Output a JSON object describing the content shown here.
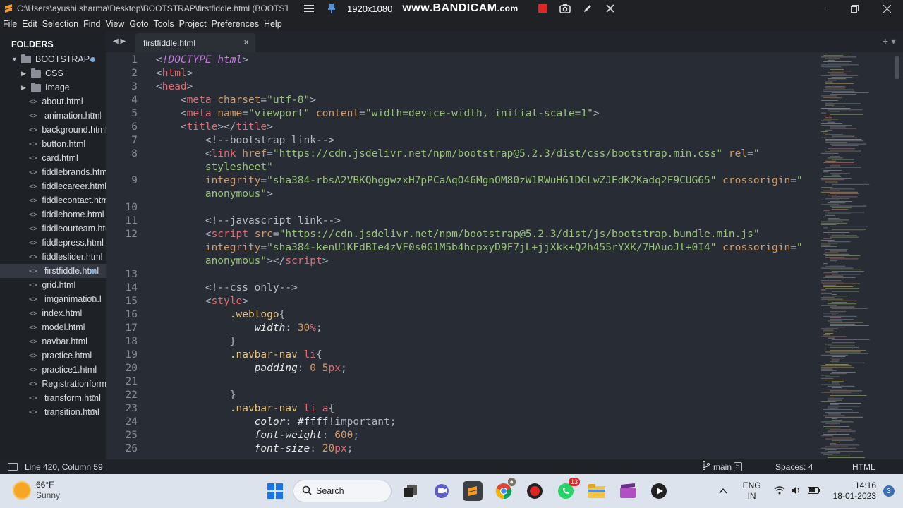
{
  "titlebar": {
    "title": "C:\\Users\\ayushi sharma\\Desktop\\BOOTSTRAP\\firstfiddle.html (BOOTSTRAP) - Sublime Text (UNREGISTERED)",
    "resolution": "1920x1080",
    "brand_main": "www.BANDICAM",
    "brand_suffix": ".com"
  },
  "menu": [
    "File",
    "Edit",
    "Selection",
    "Find",
    "View",
    "Goto",
    "Tools",
    "Project",
    "Preferences",
    "Help"
  ],
  "sidebar": {
    "header": "FOLDERS",
    "root": "BOOTSTRAP",
    "folders": [
      "CSS",
      "Image"
    ],
    "files": [
      {
        "name": "about.html",
        "mark": ""
      },
      {
        "name": "animation.html",
        "mark": "ring"
      },
      {
        "name": "background.html",
        "mark": ""
      },
      {
        "name": "button.html",
        "mark": ""
      },
      {
        "name": "card.html",
        "mark": ""
      },
      {
        "name": "fiddlebrands.html",
        "mark": ""
      },
      {
        "name": "fiddlecareer.html",
        "mark": ""
      },
      {
        "name": "fiddlecontact.html",
        "mark": ""
      },
      {
        "name": "fiddlehome.html",
        "mark": ""
      },
      {
        "name": "fiddleourteam.html",
        "mark": ""
      },
      {
        "name": "fiddlepress.html",
        "mark": ""
      },
      {
        "name": "fiddleslider.html",
        "mark": ""
      },
      {
        "name": "firstfiddle.html",
        "mark": "filled",
        "active": true
      },
      {
        "name": "grid.html",
        "mark": ""
      },
      {
        "name": "imganimation.html",
        "mark": "ring"
      },
      {
        "name": "index.html",
        "mark": ""
      },
      {
        "name": "model.html",
        "mark": ""
      },
      {
        "name": "navbar.html",
        "mark": ""
      },
      {
        "name": "practice.html",
        "mark": ""
      },
      {
        "name": "practice1.html",
        "mark": ""
      },
      {
        "name": "Registrationform.html",
        "mark": ""
      },
      {
        "name": "transform.html",
        "mark": "ring"
      },
      {
        "name": "transition.html",
        "mark": "ring"
      }
    ]
  },
  "tab": {
    "label": "firstfiddle.html",
    "close": "×"
  },
  "editor": {
    "lines": [
      {
        "n": "1",
        "tokens": [
          [
            "c-punc",
            "<"
          ],
          [
            "c-kw",
            "!DOCTYPE"
          ],
          [
            "c-txt",
            " "
          ],
          [
            "c-kw",
            "html"
          ],
          [
            "c-punc",
            ">"
          ]
        ]
      },
      {
        "n": "2",
        "tokens": [
          [
            "c-punc",
            "<"
          ],
          [
            "c-tag",
            "html"
          ],
          [
            "c-punc",
            ">"
          ]
        ]
      },
      {
        "n": "3",
        "tokens": [
          [
            "c-punc",
            "<"
          ],
          [
            "c-tag",
            "head"
          ],
          [
            "c-punc",
            ">"
          ]
        ]
      },
      {
        "n": "4",
        "tokens": [
          [
            "c-txt",
            "    "
          ],
          [
            "c-punc",
            "<"
          ],
          [
            "c-tag",
            "meta"
          ],
          [
            "c-txt",
            " "
          ],
          [
            "c-attr",
            "charset"
          ],
          [
            "c-punc",
            "="
          ],
          [
            "c-str",
            "\"utf-8\""
          ],
          [
            "c-punc",
            ">"
          ]
        ]
      },
      {
        "n": "5",
        "tokens": [
          [
            "c-txt",
            "    "
          ],
          [
            "c-punc",
            "<"
          ],
          [
            "c-tag",
            "meta"
          ],
          [
            "c-txt",
            " "
          ],
          [
            "c-attr",
            "name"
          ],
          [
            "c-punc",
            "="
          ],
          [
            "c-str",
            "\"viewport\""
          ],
          [
            "c-txt",
            " "
          ],
          [
            "c-attr",
            "content"
          ],
          [
            "c-punc",
            "="
          ],
          [
            "c-str",
            "\"width=device-width, initial-scale=1\""
          ],
          [
            "c-punc",
            ">"
          ]
        ]
      },
      {
        "n": "6",
        "tokens": [
          [
            "c-txt",
            "    "
          ],
          [
            "c-punc",
            "<"
          ],
          [
            "c-tag",
            "title"
          ],
          [
            "c-punc",
            "></"
          ],
          [
            "c-tag",
            "title"
          ],
          [
            "c-punc",
            ">"
          ]
        ]
      },
      {
        "n": "7",
        "tokens": [
          [
            "c-txt",
            "        "
          ],
          [
            "c-com",
            "<!--bootstrap link-->"
          ]
        ]
      },
      {
        "n": "8",
        "tokens": [
          [
            "c-txt",
            "        "
          ],
          [
            "c-punc",
            "<"
          ],
          [
            "c-tag",
            "link"
          ],
          [
            "c-txt",
            " "
          ],
          [
            "c-attr",
            "href"
          ],
          [
            "c-punc",
            "="
          ],
          [
            "c-str",
            "\"https://cdn.jsdelivr.net/npm/bootstrap@5.2.3/dist/css/bootstrap.min.css\""
          ],
          [
            "c-txt",
            " "
          ],
          [
            "c-attr",
            "rel"
          ],
          [
            "c-punc",
            "="
          ],
          [
            "c-str",
            "\""
          ]
        ]
      },
      {
        "n": "",
        "tokens": [
          [
            "c-txt",
            "        "
          ],
          [
            "c-str",
            "stylesheet\""
          ]
        ]
      },
      {
        "n": "9",
        "tokens": [
          [
            "c-txt",
            "        "
          ],
          [
            "c-attr",
            "integrity"
          ],
          [
            "c-punc",
            "="
          ],
          [
            "c-str",
            "\"sha384-rbsA2VBKQhggwzxH7pPCaAqO46MgnOM80zW1RWuH61DGLwZJEdK2Kadq2F9CUG65\""
          ],
          [
            "c-txt",
            " "
          ],
          [
            "c-attr",
            "crossorigin"
          ],
          [
            "c-punc",
            "="
          ],
          [
            "c-str",
            "\""
          ]
        ]
      },
      {
        "n": "",
        "tokens": [
          [
            "c-txt",
            "        "
          ],
          [
            "c-str",
            "anonymous\""
          ],
          [
            "c-punc",
            ">"
          ]
        ]
      },
      {
        "n": "10",
        "tokens": []
      },
      {
        "n": "11",
        "tokens": [
          [
            "c-txt",
            "        "
          ],
          [
            "c-com",
            "<!--javascript link-->"
          ]
        ]
      },
      {
        "n": "12",
        "tokens": [
          [
            "c-txt",
            "        "
          ],
          [
            "c-punc",
            "<"
          ],
          [
            "c-tag",
            "script"
          ],
          [
            "c-txt",
            " "
          ],
          [
            "c-attr",
            "src"
          ],
          [
            "c-punc",
            "="
          ],
          [
            "c-str",
            "\"https://cdn.jsdelivr.net/npm/bootstrap@5.2.3/dist/js/bootstrap.bundle.min.js\""
          ]
        ]
      },
      {
        "n": "",
        "tokens": [
          [
            "c-txt",
            "        "
          ],
          [
            "c-attr",
            "integrity"
          ],
          [
            "c-punc",
            "="
          ],
          [
            "c-str",
            "\"sha384-kenU1KFdBIe4zVF0s0G1M5b4hcpxyD9F7jL+jjXkk+Q2h455rYXK/7HAuoJl+0I4\""
          ],
          [
            "c-txt",
            " "
          ],
          [
            "c-attr",
            "crossorigin"
          ],
          [
            "c-punc",
            "="
          ],
          [
            "c-str",
            "\""
          ]
        ]
      },
      {
        "n": "",
        "tokens": [
          [
            "c-txt",
            "        "
          ],
          [
            "c-str",
            "anonymous\""
          ],
          [
            "c-punc",
            "></"
          ],
          [
            "c-tag",
            "script"
          ],
          [
            "c-punc",
            ">"
          ]
        ]
      },
      {
        "n": "13",
        "tokens": []
      },
      {
        "n": "14",
        "tokens": [
          [
            "c-txt",
            "        "
          ],
          [
            "c-com",
            "<!--css only-->"
          ]
        ]
      },
      {
        "n": "15",
        "tokens": [
          [
            "c-txt",
            "        "
          ],
          [
            "c-punc",
            "<"
          ],
          [
            "c-tag",
            "style"
          ],
          [
            "c-punc",
            ">"
          ]
        ]
      },
      {
        "n": "16",
        "tokens": [
          [
            "c-txt",
            "            "
          ],
          [
            "c-sel",
            ".weblogo"
          ],
          [
            "c-punc",
            "{"
          ]
        ]
      },
      {
        "n": "17",
        "tokens": [
          [
            "c-txt",
            "                "
          ],
          [
            "c-prop",
            "width"
          ],
          [
            "c-punc",
            ": "
          ],
          [
            "c-num",
            "30"
          ],
          [
            "c-unit",
            "%"
          ],
          [
            "c-punc",
            ";"
          ]
        ]
      },
      {
        "n": "18",
        "tokens": [
          [
            "c-txt",
            "            "
          ],
          [
            "c-punc",
            "}"
          ]
        ]
      },
      {
        "n": "19",
        "tokens": [
          [
            "c-txt",
            "            "
          ],
          [
            "c-sel",
            ".navbar-nav"
          ],
          [
            "c-txt",
            " "
          ],
          [
            "c-tag",
            "li"
          ],
          [
            "c-punc",
            "{"
          ]
        ]
      },
      {
        "n": "20",
        "tokens": [
          [
            "c-txt",
            "                "
          ],
          [
            "c-prop",
            "padding"
          ],
          [
            "c-punc",
            ": "
          ],
          [
            "c-num",
            "0"
          ],
          [
            "c-txt",
            " "
          ],
          [
            "c-num",
            "5"
          ],
          [
            "c-unit",
            "px"
          ],
          [
            "c-punc",
            ";"
          ]
        ]
      },
      {
        "n": "21",
        "tokens": []
      },
      {
        "n": "22",
        "tokens": [
          [
            "c-txt",
            "            "
          ],
          [
            "c-punc",
            "}"
          ]
        ]
      },
      {
        "n": "23",
        "tokens": [
          [
            "c-txt",
            "            "
          ],
          [
            "c-sel",
            ".navbar-nav"
          ],
          [
            "c-txt",
            " "
          ],
          [
            "c-tag",
            "li"
          ],
          [
            "c-txt",
            " "
          ],
          [
            "c-tag",
            "a"
          ],
          [
            "c-punc",
            "{"
          ]
        ]
      },
      {
        "n": "24",
        "tokens": [
          [
            "c-txt",
            "                "
          ],
          [
            "c-prop",
            "color"
          ],
          [
            "c-punc",
            ": "
          ],
          [
            "c-txt",
            "#ffff"
          ],
          [
            "c-punc",
            "!important;"
          ]
        ]
      },
      {
        "n": "25",
        "tokens": [
          [
            "c-txt",
            "                "
          ],
          [
            "c-prop",
            "font-weight"
          ],
          [
            "c-punc",
            ": "
          ],
          [
            "c-num",
            "600"
          ],
          [
            "c-punc",
            ";"
          ]
        ]
      },
      {
        "n": "26",
        "tokens": [
          [
            "c-txt",
            "                "
          ],
          [
            "c-prop",
            "font-size"
          ],
          [
            "c-punc",
            ": "
          ],
          [
            "c-num",
            "20"
          ],
          [
            "c-unit",
            "px"
          ],
          [
            "c-punc",
            ";"
          ]
        ]
      }
    ]
  },
  "status": {
    "position": "Line 420, Column 59",
    "branch": "main",
    "branch_count": "5",
    "spaces": "Spaces: 4",
    "syntax": "HTML"
  },
  "taskbar": {
    "temp": "66°F",
    "condition": "Sunny",
    "search_label": "Search",
    "whatsapp_badge": "13",
    "lang_top": "ENG",
    "lang_bottom": "IN",
    "time": "14:16",
    "date": "18-01-2023",
    "notifications": "3"
  }
}
